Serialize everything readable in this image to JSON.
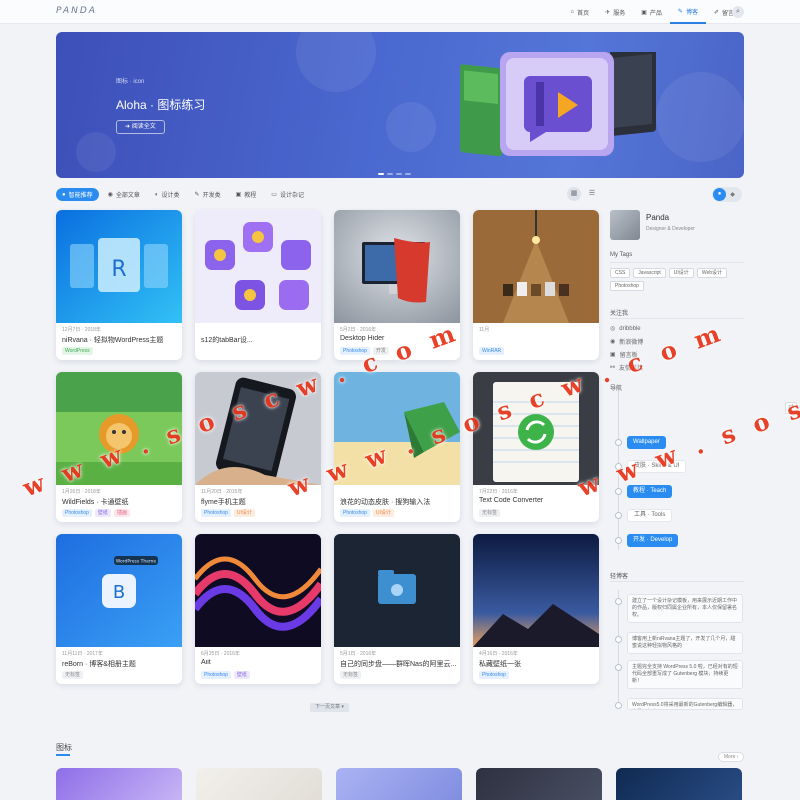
{
  "brand": "PANDA",
  "nav": [
    {
      "icon": "home-icon",
      "glyph": "⌂",
      "label": "首页",
      "active": false
    },
    {
      "icon": "plane-icon",
      "glyph": "✈",
      "label": "服务",
      "active": false
    },
    {
      "icon": "cart-icon",
      "glyph": "▣",
      "label": "产品",
      "active": false
    },
    {
      "icon": "edit-icon",
      "glyph": "✎",
      "label": "博客",
      "active": true
    },
    {
      "icon": "pen-icon",
      "glyph": "✐",
      "label": "留言板",
      "active": false
    }
  ],
  "hero": {
    "crumb": "图标 · icon",
    "title": "Aloha · 图标练习",
    "button": "➔ 阅读全文"
  },
  "tabs": [
    {
      "icon": "bulb-icon",
      "glyph": "●",
      "label": "智能推荐",
      "active": true
    },
    {
      "icon": "article-icon",
      "glyph": "◉",
      "label": "全部文章",
      "active": false
    },
    {
      "icon": "palette-icon",
      "glyph": "◐",
      "label": "设计类",
      "active": false
    },
    {
      "icon": "wrench-icon",
      "glyph": "✎",
      "label": "开发类",
      "active": false
    },
    {
      "icon": "book-icon",
      "glyph": "▣",
      "label": "教程",
      "active": false
    },
    {
      "icon": "notebook-icon",
      "glyph": "▭",
      "label": "设计杂记",
      "active": false
    }
  ],
  "cards": [
    {
      "meta": "12月7日 · 2018年",
      "title": "niRvana · 轻拟物WordPress主题",
      "tags": [
        [
          "WordPress",
          "green"
        ]
      ]
    },
    {
      "meta": "",
      "title": "s12的tabBar设...",
      "tags": []
    },
    {
      "meta": "5月2日 · 2016年",
      "title": "Desktop Hider",
      "tags": [
        [
          "Photoshop",
          "blue"
        ],
        [
          "开发",
          "gray"
        ]
      ]
    },
    {
      "meta": "11月",
      "title": "",
      "tags": [
        [
          "WinRAR",
          "blue"
        ]
      ]
    },
    {
      "meta": "1月26日 · 2018年",
      "title": "WildFields · 卡通壁纸",
      "tags": [
        [
          "Photoshop",
          "blue"
        ],
        [
          "壁纸",
          "purple"
        ],
        [
          "插画",
          "pink"
        ]
      ]
    },
    {
      "meta": "11月20日 · 2015年",
      "title": "flyme手机主题",
      "tags": [
        [
          "Photoshop",
          "blue"
        ],
        [
          "UI设计",
          "orange"
        ]
      ]
    },
    {
      "meta": "",
      "title": "浪花的动态皮肤 · 搜狗输入法",
      "tags": [
        [
          "Photoshop",
          "blue"
        ],
        [
          "UI设计",
          "orange"
        ]
      ]
    },
    {
      "meta": "7月22日 · 2016年",
      "title": "Text Code Converter",
      "tags": [
        [
          "无标签",
          "gray"
        ]
      ]
    },
    {
      "meta": "11月11日 · 2017年",
      "title": "reBorn · 博客&相册主题",
      "tags": [
        [
          "无标签",
          "gray"
        ]
      ]
    },
    {
      "meta": "6月25日 · 2016年",
      "title": "Aiit",
      "tags": [
        [
          "Photoshop",
          "blue"
        ],
        [
          "壁纸",
          "purple"
        ]
      ]
    },
    {
      "meta": "5月1日 · 2016年",
      "title": "自己的同步盘——群晖Nas的阿里云...",
      "tags": [
        [
          "无标签",
          "gray"
        ]
      ]
    },
    {
      "meta": "4月16日 · 2016年",
      "title": "私藏壁纸一张",
      "tags": [
        [
          "Photoshop",
          "blue"
        ]
      ]
    }
  ],
  "card2_thumb_text": "WordPress Theme",
  "profile": {
    "name": "Panda",
    "role": "Designer & Developer"
  },
  "my_tags_title": "My Tags",
  "my_tags": [
    "CSS",
    "Javascript",
    "UI设计",
    "Web设计",
    "Photoshop"
  ],
  "follow_title": "关注我",
  "follow": [
    {
      "icon": "dribbble-icon",
      "glyph": "◎",
      "label": "dribbble"
    },
    {
      "icon": "weibo-icon",
      "glyph": "◉",
      "label": "新浪微博"
    },
    {
      "icon": "board-icon",
      "glyph": "▣",
      "label": "留言板"
    },
    {
      "icon": "link-icon",
      "glyph": "⚯",
      "label": "友情链接"
    }
  ],
  "guide_title": "导航",
  "guide": [
    {
      "label": "Wallpaper",
      "style": "blue"
    },
    {
      "label": "皮肤 · Skins & UI",
      "style": "plain"
    },
    {
      "label": "教程 · Teach",
      "style": "blue"
    },
    {
      "label": "工具 · Tools",
      "style": "plain"
    },
    {
      "label": "开发 · Develop",
      "style": "blue"
    }
  ],
  "light_title": "轻博客",
  "messages": [
    "建立了一个设计杂记模板，用来展示近期工作中的作品，版权归同属企业所有，本人仅保留署名权。",
    "博客用上新niRvana主题了，开发了几个月，甜蜜说这种轻拟物风格的",
    "主题完全支持 WordPress 5.0 啦，已经对有的短代码全部重写成了 Gutenberg 模块，持续更新！",
    "WordPress5.0将采用最新的Gutenberg编辑器，这是五年来"
  ],
  "load_more": "下一页文章 ▾",
  "section2_title": "图标",
  "more_label": "More ›",
  "watermarks": [
    "w w w . s o s c w . c o m",
    "w w w . s o s c w . c o m",
    "w w w . s o s c w . c o m"
  ]
}
